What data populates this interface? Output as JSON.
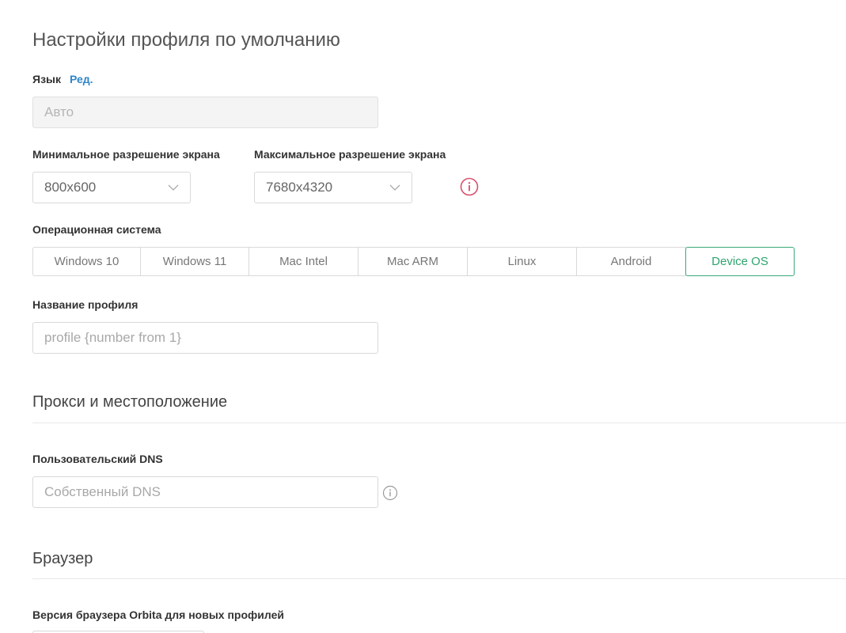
{
  "page_title": "Настройки профиля по умолчанию",
  "language": {
    "label": "Язык",
    "edit_link": "Ред.",
    "placeholder": "Авто"
  },
  "resolution": {
    "min_label": "Минимальное разрешение экрана",
    "min_value": "800x600",
    "max_label": "Максимальное разрешение экрана",
    "max_value": "7680x4320",
    "info_icon": "info-circle-icon",
    "info_color": "#d94f6b"
  },
  "os": {
    "label": "Операционная система",
    "options": [
      "Windows 10",
      "Windows 11",
      "Mac Intel",
      "Mac ARM",
      "Linux",
      "Android",
      "Device OS"
    ],
    "selected": "Device OS",
    "accent_color": "#2ea46f"
  },
  "profile_name": {
    "label": "Название профиля",
    "placeholder": "profile {number from 1}"
  },
  "proxy_section": {
    "title": "Прокси и местоположение"
  },
  "dns": {
    "label": "Пользовательский DNS",
    "placeholder": "Собственный DNS",
    "info_icon": "info-circle-icon"
  },
  "browser_section": {
    "title": "Браузер",
    "orbita_label": "Версия браузера Orbita для новых профилей"
  }
}
